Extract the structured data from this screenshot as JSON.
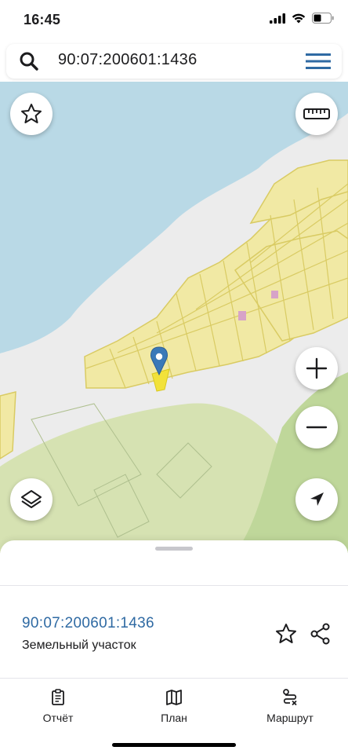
{
  "status": {
    "time": "16:45"
  },
  "search": {
    "query": "90:07:200601:1436"
  },
  "map": {
    "colors": {
      "water": "#b9d9e6",
      "land": "#ececec",
      "green": "#d6e2b2",
      "parcel": "#f1e9a4",
      "parcel_border": "#d9cb63",
      "pin": "#3a79b8",
      "selected": "#f2e23a"
    },
    "buttons": [
      "favorite-icon",
      "ruler-icon",
      "zoom-in-icon",
      "zoom-out-icon",
      "layers-icon",
      "locate-icon"
    ]
  },
  "sheet": {
    "parcel_id": "90:07:200601:1436",
    "parcel_type": "Земельный участок"
  },
  "tabs": [
    {
      "label": "Отчёт",
      "icon": "report-icon"
    },
    {
      "label": "План",
      "icon": "map-icon"
    },
    {
      "label": "Маршрут",
      "icon": "route-icon"
    }
  ]
}
